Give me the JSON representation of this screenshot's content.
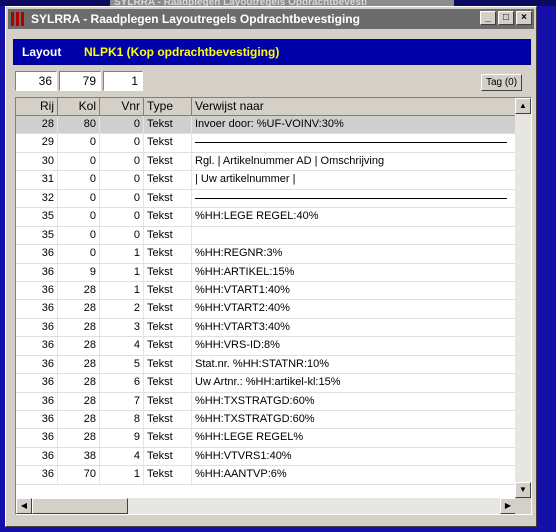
{
  "background_window": {
    "title": "SYLRRA - Raadplegen Layoutregels Opdrachtbevesti"
  },
  "window": {
    "title": "SYLRRA - Raadplegen Layoutregels Opdrachtbevestiging",
    "buttons": {
      "minimize": "_",
      "maximize": "□",
      "close": "×"
    }
  },
  "layout": {
    "label": "Layout",
    "value": "NLPK1  (Kop opdrachtbevestiging)"
  },
  "filters": {
    "rij": "36",
    "kol": "79",
    "vnr": "1"
  },
  "tag_button": {
    "label": "Tag (0)"
  },
  "columns": [
    "Rij",
    "Kol",
    "Vnr",
    "Type",
    "Verwijst naar"
  ],
  "rows": [
    {
      "rij": "28",
      "kol": "80",
      "vnr": "0",
      "type": "Tekst",
      "ref": "Invoer door: %UF-VOINV:30%",
      "selected": true
    },
    {
      "rij": "29",
      "kol": "0",
      "vnr": "0",
      "type": "Tekst",
      "ref": "",
      "line": true
    },
    {
      "rij": "30",
      "kol": "0",
      "vnr": "0",
      "type": "Tekst",
      "ref": "Rgl.    | Artikelnummer AD  | Omschrijving"
    },
    {
      "rij": "31",
      "kol": "0",
      "vnr": "0",
      "type": "Tekst",
      "ref": "          | Uw artikelnummer  |"
    },
    {
      "rij": "32",
      "kol": "0",
      "vnr": "0",
      "type": "Tekst",
      "ref": "",
      "line": true
    },
    {
      "rij": "35",
      "kol": "0",
      "vnr": "0",
      "type": "Tekst",
      "ref": "%HH:LEGE REGEL:40%"
    },
    {
      "rij": "35",
      "kol": "0",
      "vnr": "0",
      "type": "Tekst",
      "ref": ""
    },
    {
      "rij": "36",
      "kol": "0",
      "vnr": "1",
      "type": "Tekst",
      "ref": "%HH:REGNR:3%"
    },
    {
      "rij": "36",
      "kol": "9",
      "vnr": "1",
      "type": "Tekst",
      "ref": "%HH:ARTIKEL:15%"
    },
    {
      "rij": "36",
      "kol": "28",
      "vnr": "1",
      "type": "Tekst",
      "ref": "%HH:VTART1:40%"
    },
    {
      "rij": "36",
      "kol": "28",
      "vnr": "2",
      "type": "Tekst",
      "ref": "%HH:VTART2:40%"
    },
    {
      "rij": "36",
      "kol": "28",
      "vnr": "3",
      "type": "Tekst",
      "ref": "%HH:VTART3:40%"
    },
    {
      "rij": "36",
      "kol": "28",
      "vnr": "4",
      "type": "Tekst",
      "ref": "%HH:VRS-ID:8%"
    },
    {
      "rij": "36",
      "kol": "28",
      "vnr": "5",
      "type": "Tekst",
      "ref": "Stat.nr.  %HH:STATNR:10%"
    },
    {
      "rij": "36",
      "kol": "28",
      "vnr": "6",
      "type": "Tekst",
      "ref": "Uw Artnr.: %HH:artikel-kl:15%"
    },
    {
      "rij": "36",
      "kol": "28",
      "vnr": "7",
      "type": "Tekst",
      "ref": "%HH:TXSTRATGD:60%"
    },
    {
      "rij": "36",
      "kol": "28",
      "vnr": "8",
      "type": "Tekst",
      "ref": "%HH:TXSTRATGD:60%"
    },
    {
      "rij": "36",
      "kol": "28",
      "vnr": "9",
      "type": "Tekst",
      "ref": "%HH:LEGE REGEL%"
    },
    {
      "rij": "36",
      "kol": "38",
      "vnr": "4",
      "type": "Tekst",
      "ref": "%HH:VTVRS1:40%"
    },
    {
      "rij": "36",
      "kol": "70",
      "vnr": "1",
      "type": "Tekst",
      "ref": "%HH:AANTVP:6%"
    }
  ],
  "icons": {
    "app": "app-icon",
    "scroll_up": "arrow-up-icon",
    "scroll_down": "arrow-down-icon",
    "scroll_left": "arrow-left-icon",
    "scroll_right": "arrow-right-icon"
  },
  "colors": {
    "desktop": "#1410a8",
    "layout_bar": "#0000a8",
    "layout_value": "#ffff00",
    "title_bar": "#6c6c6c"
  }
}
